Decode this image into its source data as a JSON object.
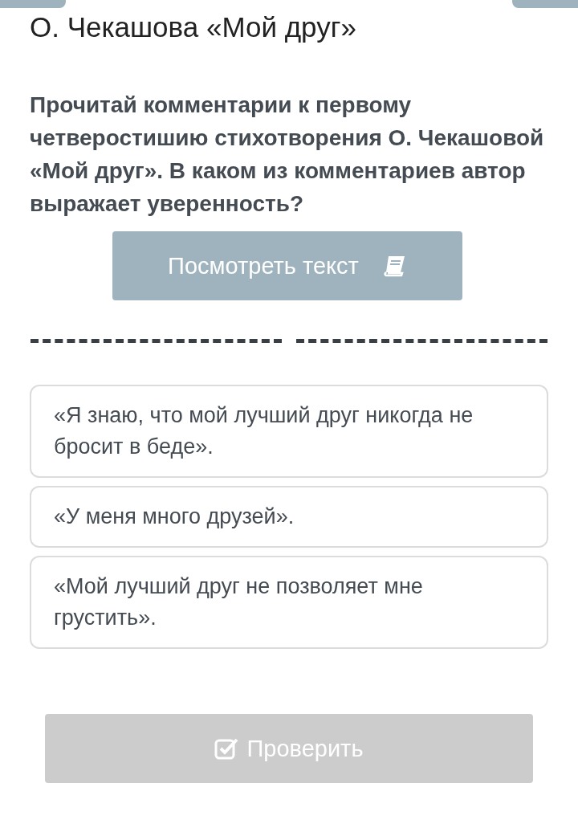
{
  "title": "О. Чекашова «Мой друг»",
  "question": "Прочитай комментарии к первому четверостишию стихотворения О. Чекашовой «Мой друг». В каком из комментариев автор выражает уверенность?",
  "view_button": {
    "label": "Посмотреть текст"
  },
  "blanks": [
    {
      "filled": false
    },
    {
      "filled": false
    }
  ],
  "options": [
    {
      "text": "«Я знаю, что мой лучший друг никогда не бросит в беде».",
      "selected": false
    },
    {
      "text": "«У меня много друзей».",
      "selected": false
    },
    {
      "text": "«Мой лучший друг не позволяет мне грустить».",
      "selected": false
    }
  ],
  "check_button": {
    "label": "Проверить",
    "disabled": true
  }
}
